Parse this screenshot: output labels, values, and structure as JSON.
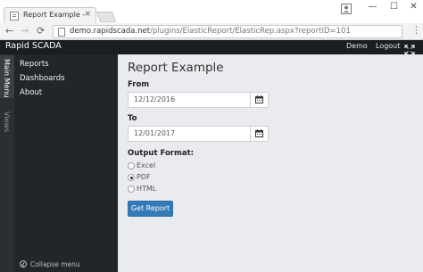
{
  "browser": {
    "tab_title": "Report Example - Elastic",
    "tab_close": "×",
    "url_host": "demo.rapidscada.net",
    "url_path": "/plugins/ElasticReport/ElasticRep.aspx?reportID=101",
    "controls": {
      "back": "←",
      "forward": "→",
      "reload": "⟳",
      "menu": "⋮"
    },
    "window": {
      "minimize": "—",
      "maximize": "☐",
      "close": "✕"
    }
  },
  "navbar": {
    "brand": "Rapid SCADA",
    "links": [
      "Demo",
      "Logout"
    ]
  },
  "side_tabs": {
    "main_menu": "Main Menu",
    "views": "Views"
  },
  "sidebar": {
    "items": [
      "Reports",
      "Dashboards",
      "About"
    ],
    "collapse_label": "Collapse menu"
  },
  "form": {
    "title": "Report Example",
    "from_label": "From",
    "from_value": "12/12/2016",
    "to_label": "To",
    "to_value": "12/01/2017",
    "format_label": "Output Format:",
    "formats": [
      "Excel",
      "PDF",
      "HTML"
    ],
    "selected_format": "PDF",
    "submit_label": "Get Report"
  },
  "colors": {
    "navbar_bg": "#1b1e21",
    "sidebar_bg": "#222629",
    "content_bg": "#e9ebee",
    "primary_button": "#337ab7"
  },
  "icons": {
    "calendar": "calendar-icon",
    "expand": "fullscreen-icon",
    "collapse": "collapse-circle-icon",
    "user": "profile-icon"
  }
}
